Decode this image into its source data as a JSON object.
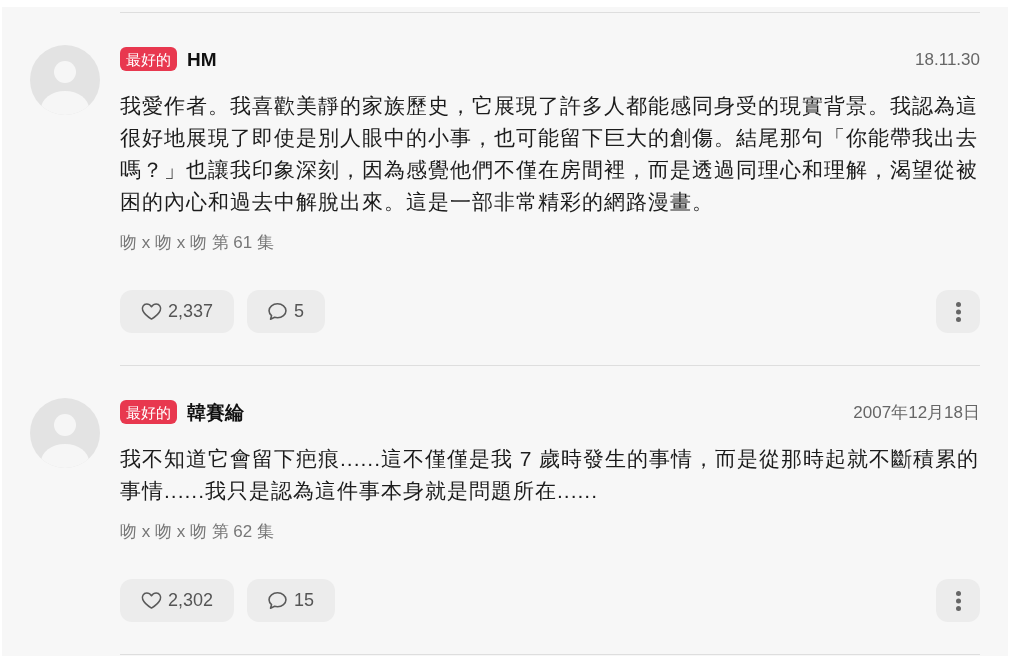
{
  "comments": [
    {
      "badge": "最好的",
      "author": "HM",
      "date": "18.11.30",
      "body": "我愛作者。我喜歡美靜的家族歷史，它展現了許多人都能感同身受的現實背景。我認為這很好地展現了即使是別人眼中的小事，也可能留下巨大的創傷。結尾那句「你能帶我出去嗎？」也讓我印象深刻，因為感覺他們不僅在房間裡，而是透過同理心和理解，渴望從被困的內心和過去中解脫出來。這是一部非常精彩的網路漫畫。",
      "episode": "吻 x 吻 x 吻 第 61 集",
      "likes": "2,337",
      "replies": "5"
    },
    {
      "badge": "最好的",
      "author": "韓賽綸",
      "date": "2007年12月18日",
      "body": "我不知道它會留下疤痕......這不僅僅是我 7 歲時發生的事情，而是從那時起就不斷積累的事情......我只是認為這件事本身就是問題所在......",
      "episode": "吻 x 吻 x 吻 第 62 集",
      "likes": "2,302",
      "replies": "15"
    }
  ]
}
